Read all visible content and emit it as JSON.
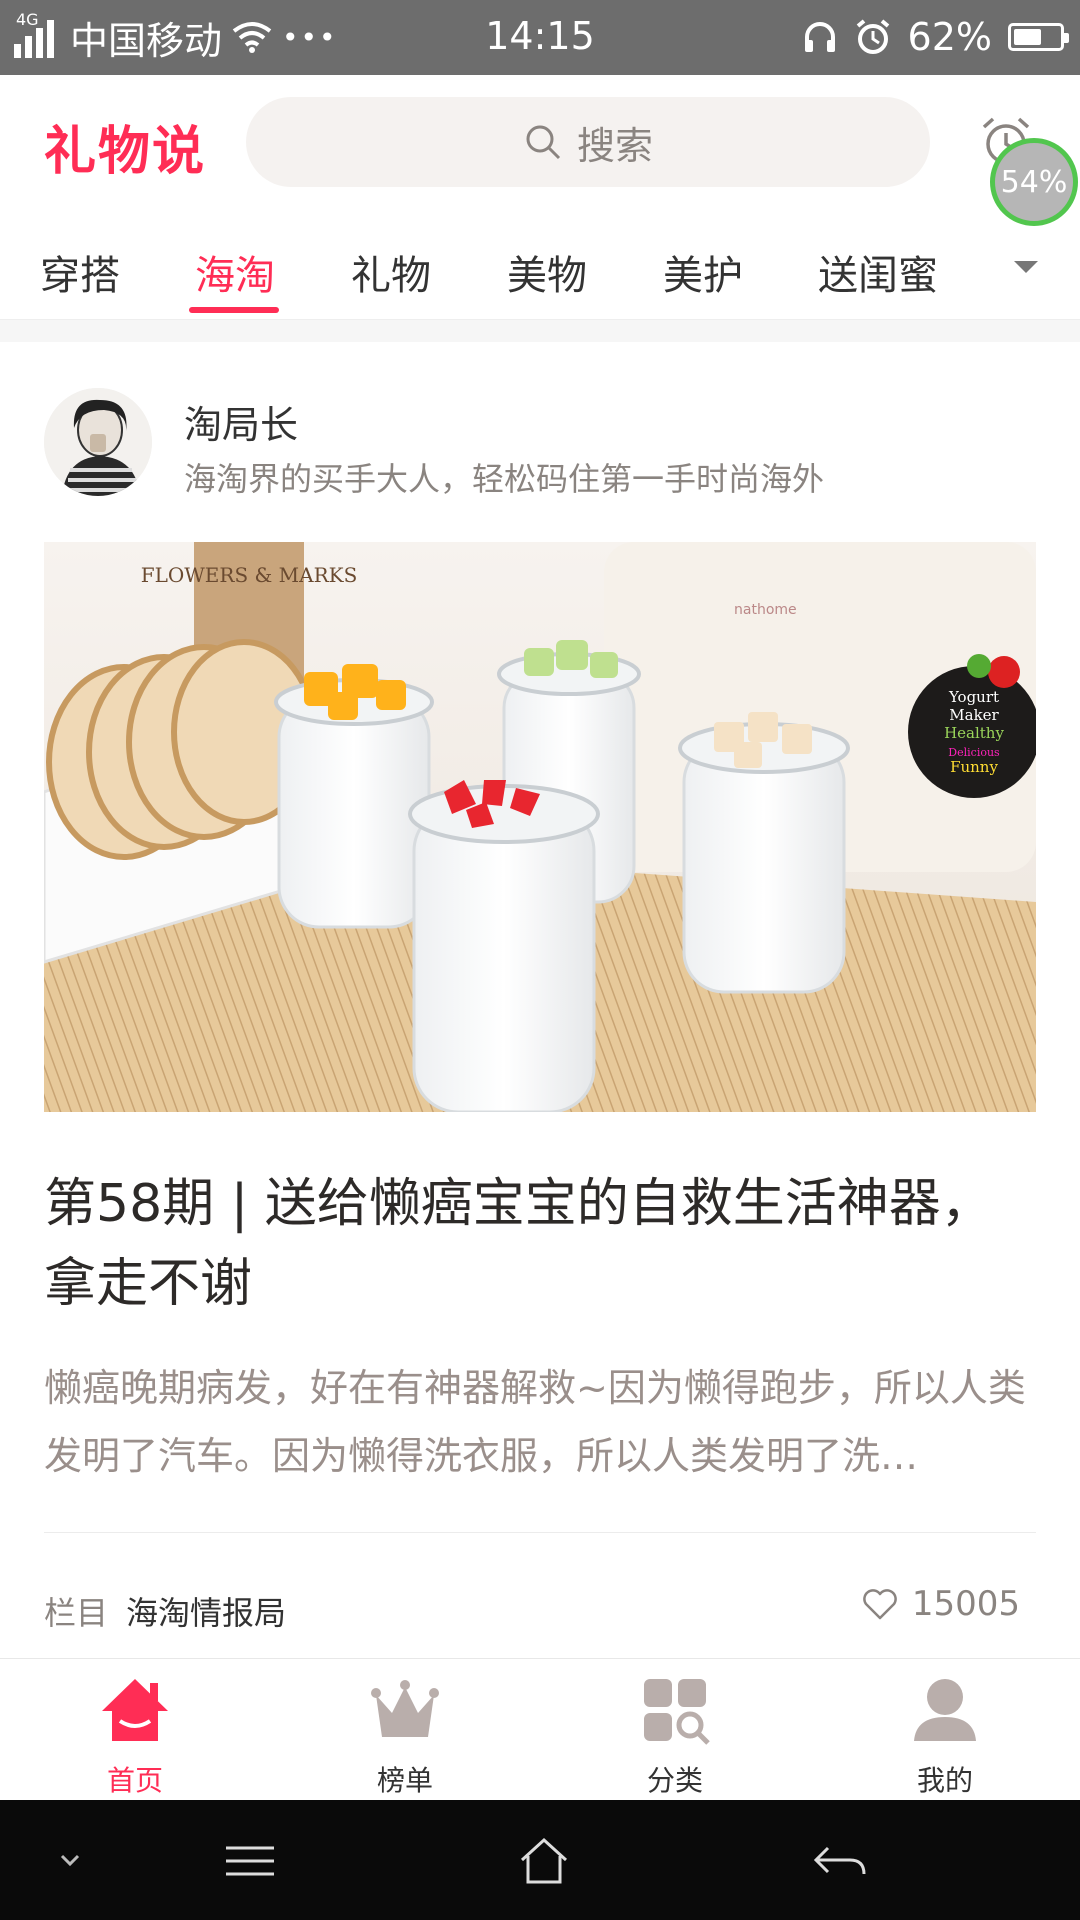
{
  "status_bar": {
    "network": "4G",
    "carrier": "中国移动",
    "more": "•••",
    "time": "14:15",
    "battery": "62%",
    "battery_level": 0.62
  },
  "header": {
    "logo": "礼物说",
    "search_placeholder": "搜索",
    "perf_badge": "54%"
  },
  "tabs": [
    {
      "label": "穿搭",
      "active": false
    },
    {
      "label": "海淘",
      "active": true
    },
    {
      "label": "礼物",
      "active": false
    },
    {
      "label": "美物",
      "active": false
    },
    {
      "label": "美护",
      "active": false
    },
    {
      "label": "送闺蜜",
      "active": false
    }
  ],
  "card": {
    "author": {
      "name": "淘局长",
      "bio": "海淘界的买手大人，轻松码住第一手时尚海外"
    },
    "cover": {
      "sign_text": "FLOWERS & MARKS",
      "brand": "nathome",
      "label_lines": [
        "Yogurt",
        "Maker",
        "Healthy",
        "Delicious",
        "Funny"
      ]
    },
    "title": "第58期 | 送给懒癌宝宝的自救生活神器，拿走不谢",
    "summary": "懒癌晚期病发，好在有神器解救~因为懒得跑步，所以人类发明了汽车。因为懒得洗衣服，所以人类发明了洗…",
    "column_label": "栏目",
    "column_name": "海淘情报局",
    "likes": "15005"
  },
  "bottom_nav": [
    {
      "label": "首页",
      "icon": "home-icon",
      "active": true
    },
    {
      "label": "榜单",
      "icon": "crown-icon",
      "active": false
    },
    {
      "label": "分类",
      "icon": "category-icon",
      "active": false
    },
    {
      "label": "我的",
      "icon": "profile-icon",
      "active": false
    }
  ],
  "colors": {
    "accent": "#ff2d55",
    "muted_text": "#8a8480",
    "inactive_icon": "#b9aeab",
    "status_bar": "#6d6d6d",
    "system_nav": "#0a0a0a"
  }
}
